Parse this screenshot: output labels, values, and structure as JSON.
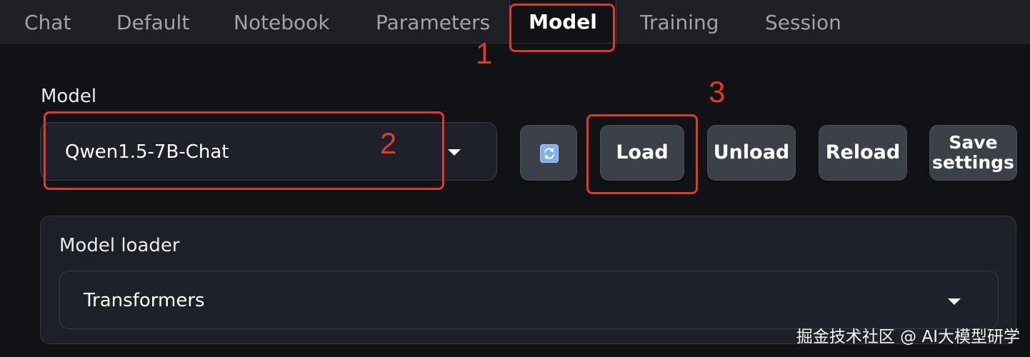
{
  "tabs": [
    {
      "label": "Chat"
    },
    {
      "label": "Default"
    },
    {
      "label": "Notebook"
    },
    {
      "label": "Parameters"
    },
    {
      "label": "Model",
      "active": true
    },
    {
      "label": "Training"
    },
    {
      "label": "Session"
    }
  ],
  "model": {
    "label": "Model",
    "selected": "Qwen1.5-7B-Chat"
  },
  "buttons": {
    "refresh_icon": "refresh-icon",
    "load": "Load",
    "unload": "Unload",
    "reload": "Reload",
    "save_line1": "Save",
    "save_line2": "settings"
  },
  "loader": {
    "label": "Model loader",
    "selected": "Transformers"
  },
  "annotations": {
    "step1": "1",
    "step2": "2",
    "step3": "3",
    "color": "#e0392b"
  },
  "watermark": "掘金技术社区 @ AI大模型研学"
}
